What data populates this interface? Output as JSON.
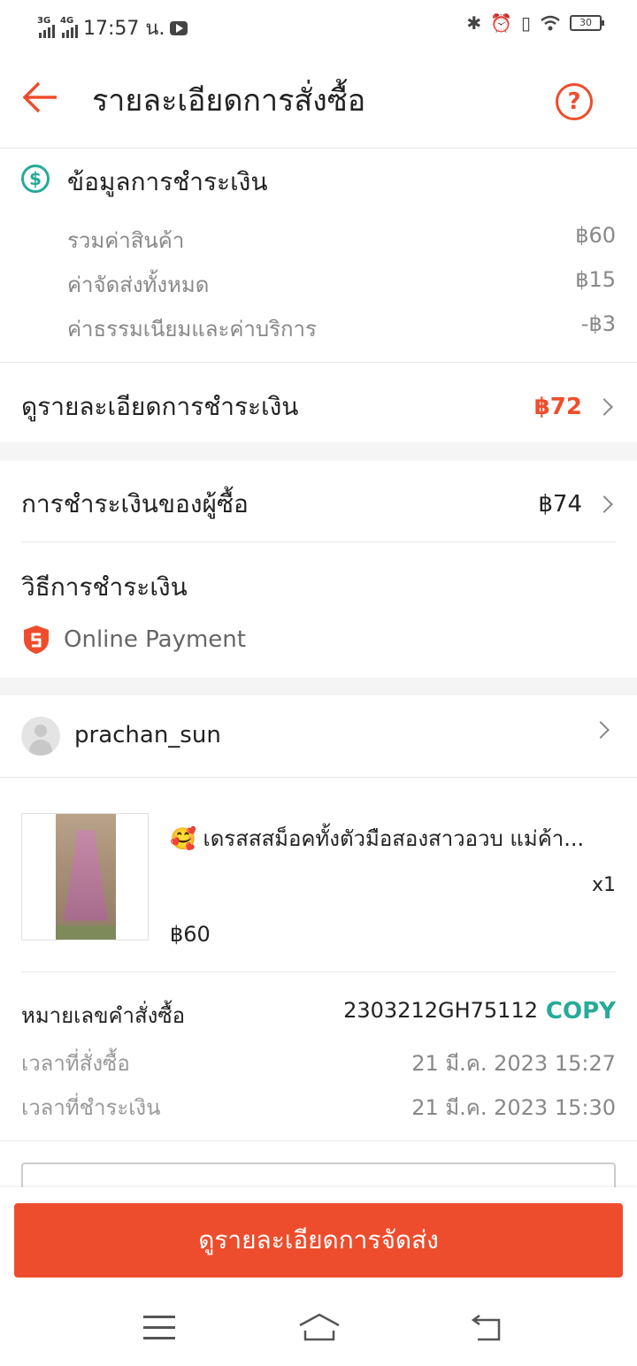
{
  "status_bar": {
    "net1": "3G",
    "net2": "4G",
    "time": "17:57 น.",
    "battery": "30"
  },
  "header": {
    "title": "รายละเอียดการสั่งซื้อ",
    "help_symbol": "?"
  },
  "payment_info": {
    "icon_symbol": "$",
    "title": "ข้อมูลการชำระเงิน",
    "lines": [
      {
        "label": "รวมค่าสินค้า",
        "value": "฿60"
      },
      {
        "label": "ค่าจัดส่งทั้งหมด",
        "value": "฿15"
      },
      {
        "label": "ค่าธรรมเนียมและค่าบริการ",
        "value": "-฿3"
      }
    ],
    "details_label": "ดูรายละเอียดการชำระเงิน",
    "details_total": "฿72"
  },
  "buyer_payment": {
    "label": "การชำระเงินของผู้ซื้อ",
    "value": "฿74"
  },
  "payment_method": {
    "title": "วิธีการชำระเงิน",
    "method": "Online Payment"
  },
  "shop": {
    "name": "prachan_sun"
  },
  "product": {
    "title": "🥰 เดรสสสม็อคทั้งตัวมือสองสาวอวบ แม่ค้า...",
    "qty": "x1",
    "price": "฿60"
  },
  "order": {
    "number_label": "หมายเลขคำสั่งซื้อ",
    "number": "2303212GH75112",
    "copy_label": "COPY",
    "order_time_label": "เวลาที่สั่งซื้อ",
    "order_time": "21 มี.ค. 2023 15:27",
    "pay_time_label": "เวลาที่ชำระเงิน",
    "pay_time": "21 มี.ค. 2023 15:30"
  },
  "actions": {
    "primary": "ดูรายละเอียดการจัดส่ง"
  },
  "colors": {
    "accent": "#ee4d2d",
    "teal": "#26aa99"
  }
}
